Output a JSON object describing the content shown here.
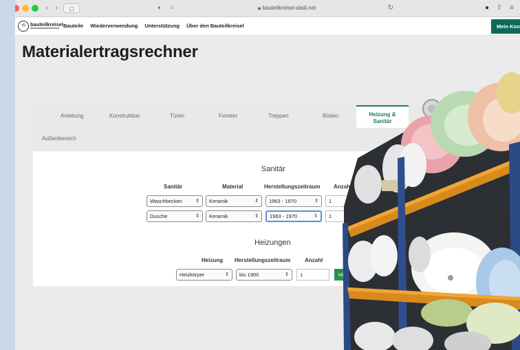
{
  "browser": {
    "url": "bauteilkreisel-dadi.net",
    "buttons": {
      "back": "‹",
      "forward": "›",
      "sidebar": "▢",
      "shield": "◐",
      "reader": "≡",
      "reload": "↻",
      "download": "●",
      "share": "⇧",
      "tabs": "≡"
    }
  },
  "site": {
    "logo_text": "bauteilkreisel",
    "nav": [
      "Bauteile",
      "Wiederverwendung",
      "Unterstützung",
      "Über den Bauteilkreisel"
    ],
    "account_label": "Mein Konto"
  },
  "page": {
    "title": "Materialertragsrechner"
  },
  "tabs": {
    "items": [
      "Anleitung",
      "Konstruktion",
      "Türen",
      "Fenster",
      "Treppen",
      "Böden",
      "Heizung & Sanitär",
      "Außenbereich"
    ],
    "active": "Heizung & Sanitär"
  },
  "sanitaer": {
    "title": "Sanitär",
    "headers": [
      "Sanitär",
      "Material",
      "Herstellungszeitraum",
      "Anzahl"
    ],
    "rows": [
      {
        "item": "Waschbecken",
        "material": "Keramik",
        "period": "1963 - 1970",
        "count": "1"
      },
      {
        "item": "Dusche",
        "material": "Keramik",
        "period": "1963 - 1970",
        "count": "1"
      }
    ]
  },
  "heizungen": {
    "title": "Heizungen",
    "headers": [
      "Heizung",
      "Herstellungszeitraum",
      "Anzahl"
    ],
    "rows": [
      {
        "item": "Heizkörper",
        "period": "bis 1900",
        "count": "1",
        "button": "Hi"
      }
    ]
  },
  "colors": {
    "accent": "#1a7a5e",
    "button_green": "#2e8f4a",
    "account_bg": "#0d6b57",
    "focus": "#5b8fd6"
  }
}
